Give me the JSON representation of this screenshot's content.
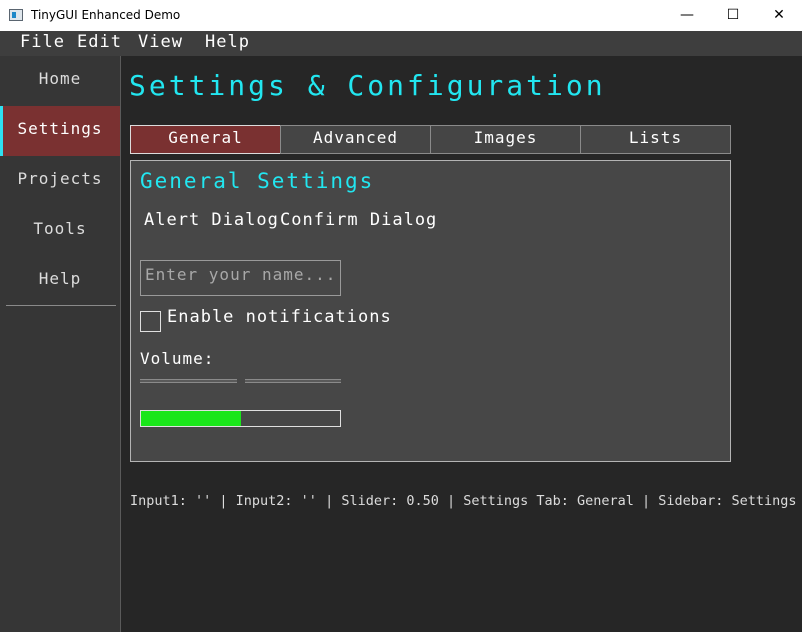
{
  "window": {
    "title": "TinyGUI Enhanced Demo",
    "min_symbol": "—",
    "max_symbol": "☐",
    "close_symbol": "✕"
  },
  "menu": {
    "items": [
      "File",
      "Edit",
      "View",
      "Help"
    ]
  },
  "sidebar": {
    "items": [
      {
        "label": "Home",
        "active": false
      },
      {
        "label": "Settings",
        "active": true
      },
      {
        "label": "Projects",
        "active": false
      },
      {
        "label": "Tools",
        "active": false
      },
      {
        "label": "Help",
        "active": false
      }
    ]
  },
  "main": {
    "title": "Settings & Configuration",
    "tabs": [
      {
        "label": "General",
        "active": true
      },
      {
        "label": "Advanced",
        "active": false
      },
      {
        "label": "Images",
        "active": false
      },
      {
        "label": "Lists",
        "active": false
      }
    ],
    "panel": {
      "title": "General Settings",
      "alert_button": "Alert Dialog",
      "confirm_button": "Confirm Dialog",
      "name_input": {
        "value": "",
        "placeholder": "Enter your name..."
      },
      "notifications": {
        "label": "Enable notifications",
        "checked": false
      },
      "volume": {
        "label": "Volume:",
        "value": 0.5
      },
      "progress": {
        "value": 0.5
      }
    },
    "status": "Input1: '' | Input2: '' | Slider: 0.50 | Settings Tab: General | Sidebar: Settings"
  },
  "colors": {
    "accent": "#22e6f0",
    "active_bg": "#7a3131",
    "progress_fill": "#1ae61a",
    "background": "#262626"
  }
}
